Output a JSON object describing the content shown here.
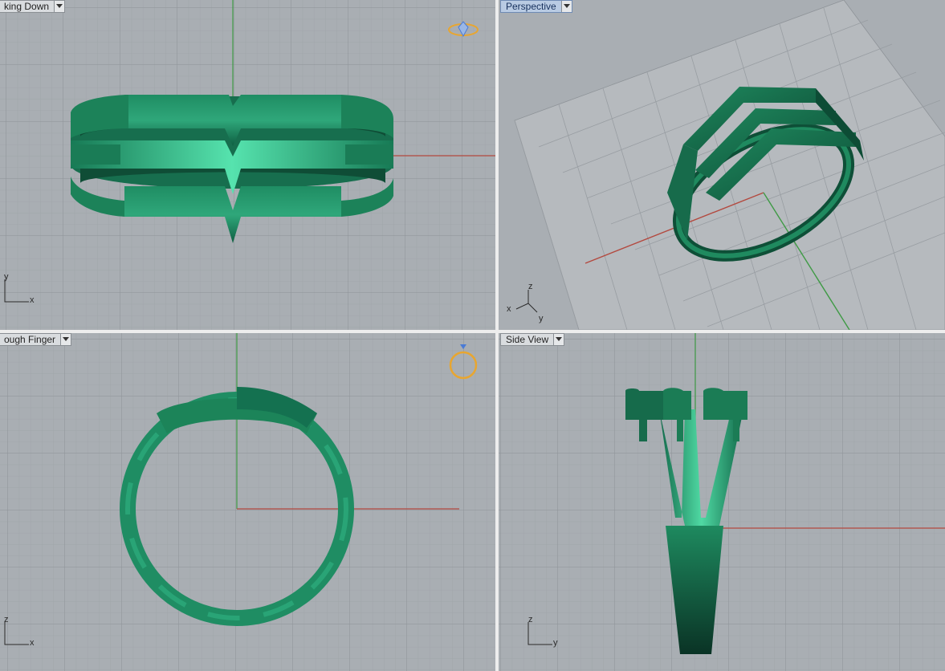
{
  "viewports": {
    "top": {
      "title": "king Down",
      "axis": {
        "v": "y",
        "h": "x"
      }
    },
    "perspective": {
      "title": "Perspective",
      "axis": {
        "up": "z",
        "left": "x",
        "right": "y"
      }
    },
    "front": {
      "title": "ough Finger",
      "axis": {
        "v": "z",
        "h": "x"
      }
    },
    "side": {
      "title": "Side View",
      "axis": {
        "v": "z",
        "h": "y"
      }
    }
  },
  "icons": {
    "top_view": "ring-gem-top-icon",
    "front_view": "ring-front-icon",
    "dropdown": "chevron-down-icon"
  },
  "colors": {
    "viewport_bg": "#a9aeb3",
    "grid_minor": "#a0a5aa",
    "grid_major": "#8e9398",
    "x_axis": "#b3493f",
    "y_axis": "#3f9a45",
    "model": "#1f8a63",
    "model_highlight": "#3ecf99",
    "active_tab": "#b9cbe3",
    "icon_gold": "#e8a630",
    "icon_blue": "#4a7bd6"
  }
}
